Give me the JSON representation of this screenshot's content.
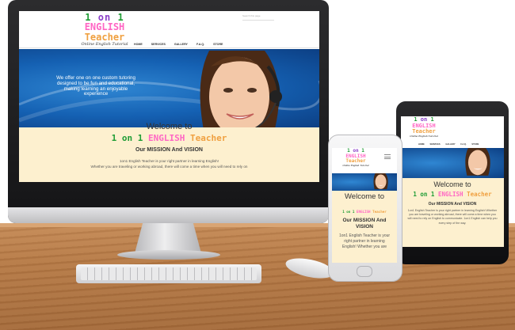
{
  "site": {
    "logo": {
      "num1": "1",
      "on": "on",
      "num2": "1",
      "english": "ENGLISH",
      "teacher": "Teacher",
      "tagline": "Online English Tutorial"
    },
    "search_placeholder": "Search this page",
    "nav": [
      "HOME",
      "SERVICES",
      "GALLERY",
      "F.A.Q.",
      "STORE"
    ],
    "hero_text": "We offer one on one custom tutoring designed to be fun and educational, making learning an enjoyable experience",
    "welcome": "Welcome to",
    "brand": {
      "part1": "1",
      "part2": "on",
      "part3": "1",
      "part4": "ENGLISH",
      "part5": "Teacher"
    },
    "mission_title": "Our MISSION And VISION",
    "mission_line1": "1on1 English Teacher is your right partner in learning English!",
    "mission_line2": "Whether you are traveling or working abroad, there will come a time when you will need to rely on",
    "tablet_para": "1on1 English Teacher is your right partner in learning English! Whether you are traveling or working abroad, there will come a time when you will need to rely on English to communicate. 1on1 English can help you every step of the way.",
    "phone_para": "1on1 English Teacher is your right partner in learning English! Whether you are",
    "phone_mission": "Our MISSION And VISION"
  },
  "colors": {
    "green": "#1e9c34",
    "pink": "#ff66c4",
    "orange": "#f0a040",
    "purple": "#8b3fc9",
    "hero_blue": "#1561b3",
    "cream": "#fdf0cf"
  }
}
